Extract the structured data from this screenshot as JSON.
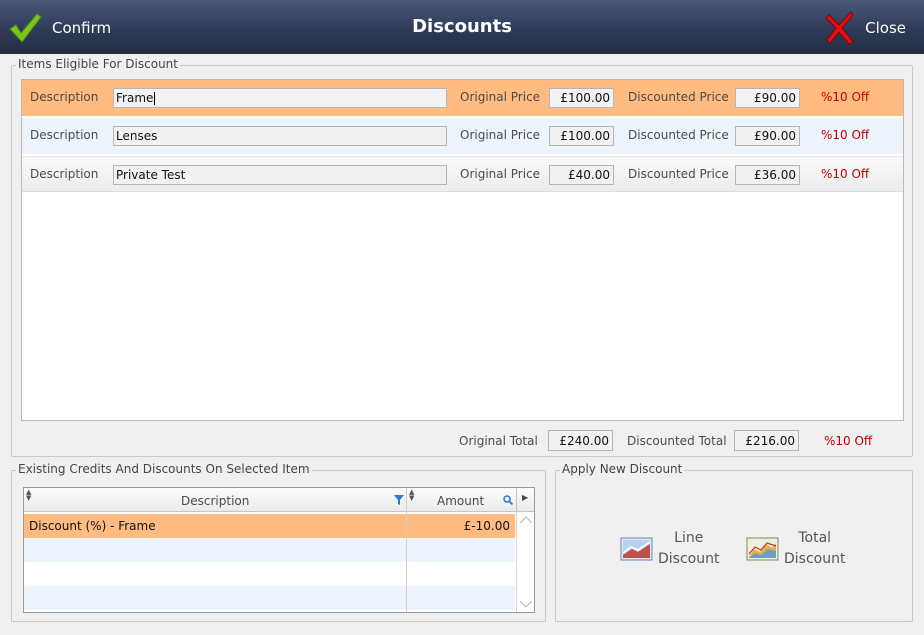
{
  "window": {
    "title": "Discounts",
    "confirm_label": "Confirm",
    "close_label": "Close"
  },
  "items_group": {
    "legend": "Items Eligible For Discount",
    "labels": {
      "description": "Description",
      "original_price": "Original Price",
      "discounted_price": "Discounted Price"
    },
    "rows": [
      {
        "description": "Frame",
        "original_price": "£100.00",
        "discounted_price": "£90.00",
        "off": "%10 Off"
      },
      {
        "description": "Lenses",
        "original_price": "£100.00",
        "discounted_price": "£90.00",
        "off": "%10 Off"
      },
      {
        "description": "Private Test",
        "original_price": "£40.00",
        "discounted_price": "£36.00",
        "off": "%10 Off"
      }
    ],
    "totals": {
      "original_total_label": "Original Total",
      "original_total": "£240.00",
      "discounted_total_label": "Discounted Total",
      "discounted_total": "£216.00",
      "off": "%10 Off"
    }
  },
  "credits_group": {
    "legend": "Existing Credits And Discounts On Selected Item",
    "columns": {
      "description": "Description",
      "amount": "Amount"
    },
    "rows": [
      {
        "description": "Discount (%) - Frame",
        "amount": "£-10.00"
      }
    ]
  },
  "apply_group": {
    "legend": "Apply New Discount",
    "line_discount": {
      "line1": "Line",
      "line2": "Discount"
    },
    "total_discount": {
      "line1": "Total",
      "line2": "Discount"
    }
  },
  "colors": {
    "selected_row": "#ffbb80",
    "off_text": "#c00000",
    "titlebar": "#2f3b57"
  }
}
